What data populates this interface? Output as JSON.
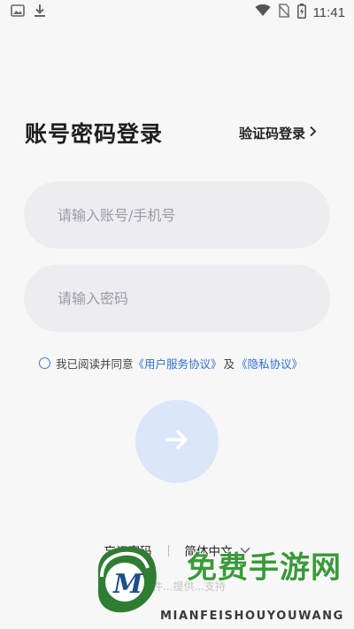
{
  "status_bar": {
    "time": "11:41",
    "left_icons": [
      "image-icon",
      "download-icon"
    ],
    "right_icons": [
      "wifi-icon",
      "no-sim-icon",
      "battery-charging-icon"
    ]
  },
  "header": {
    "title": "账号密码登录",
    "switch_label": "验证码登录"
  },
  "form": {
    "account_placeholder": "请输入账号/手机号",
    "account_value": "",
    "password_placeholder": "请输入密码",
    "password_value": ""
  },
  "agreement": {
    "checked": false,
    "prefix": "我已阅读并同意",
    "user_agreement": "《用户服务协议》",
    "conjunction": "及",
    "privacy_policy": "《隐私协议》"
  },
  "submit": {
    "icon": "arrow-right-icon"
  },
  "bottom": {
    "forgot_password": "忘记密码",
    "language": "简体中文"
  },
  "footer_note": "软件...提供...支持",
  "watermark": {
    "title": "免费手游网",
    "subtitle": "MIANFEISHOUYOUWANG"
  },
  "colors": {
    "accent": "#2f6fd0",
    "submit_disabled": "#dbe7f8",
    "input_bg": "#ededf1",
    "background": "#f7f7f7"
  }
}
